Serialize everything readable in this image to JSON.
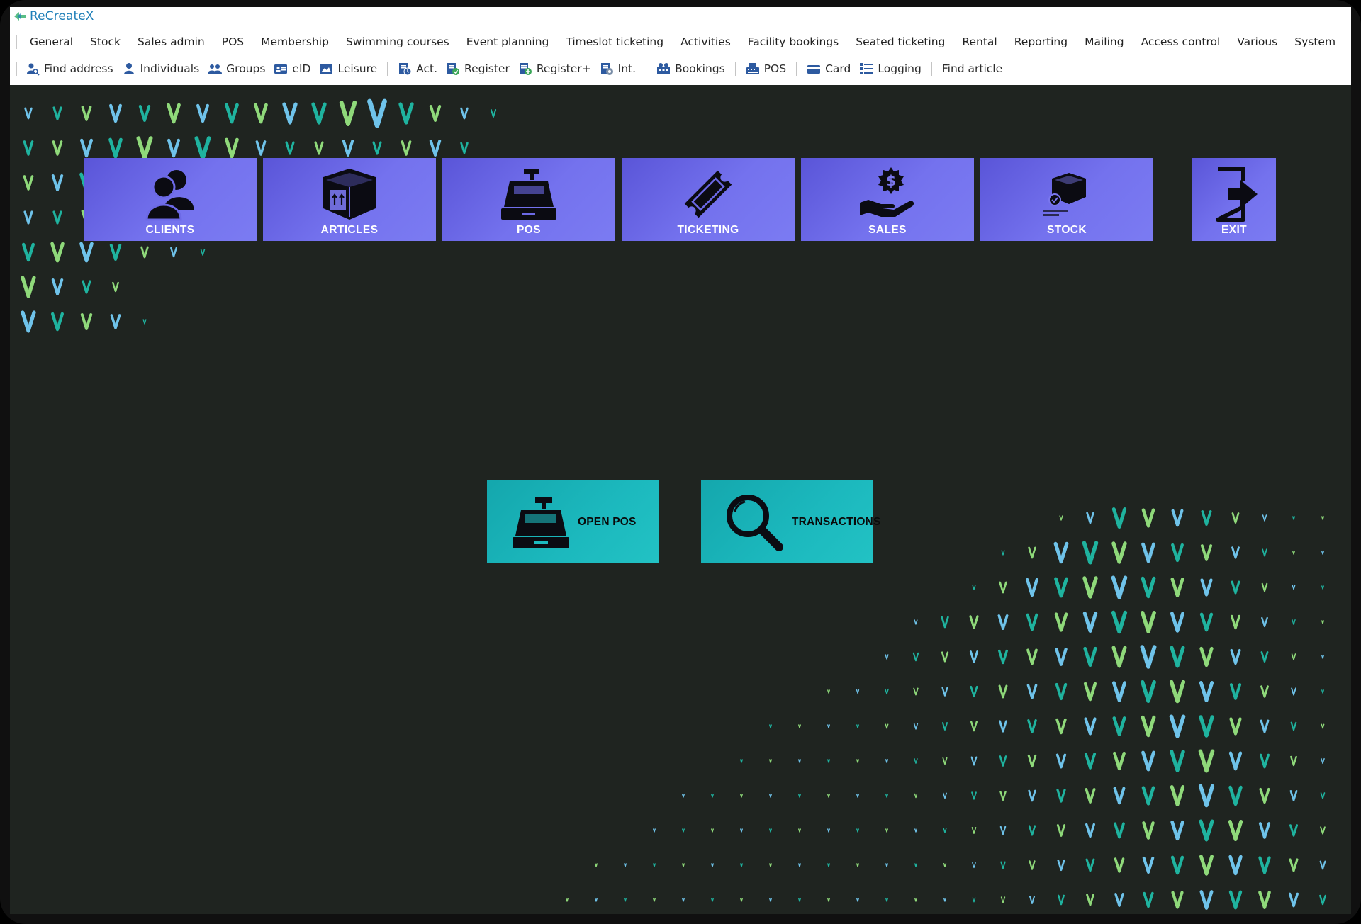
{
  "app": {
    "title": "ReCreateX"
  },
  "menubar": {
    "items": [
      "General",
      "Stock",
      "Sales admin",
      "POS",
      "Membership",
      "Swimming courses",
      "Event planning",
      "Timeslot ticketing",
      "Activities",
      "Facility bookings",
      "Seated ticketing",
      "Rental",
      "Reporting",
      "Mailing",
      "Access control",
      "Various",
      "System"
    ]
  },
  "toolbar": {
    "find_address": {
      "label": "Find address",
      "icon": "find-address-icon"
    },
    "individuals": {
      "label": "Individuals",
      "icon": "person-icon"
    },
    "groups": {
      "label": "Groups",
      "icon": "group-icon"
    },
    "eid": {
      "label": "eID",
      "icon": "id-card-icon"
    },
    "leisure": {
      "label": "Leisure",
      "icon": "picture-icon"
    },
    "act": {
      "label": "Act.",
      "icon": "activity-icon"
    },
    "register": {
      "label": "Register",
      "icon": "register-icon"
    },
    "register_plus": {
      "label": "Register+",
      "icon": "register-plus-icon"
    },
    "int": {
      "label": "Int.",
      "icon": "interest-icon"
    },
    "bookings": {
      "label": "Bookings",
      "icon": "bookings-icon"
    },
    "pos": {
      "label": "POS",
      "icon": "cash-register-icon"
    },
    "card": {
      "label": "Card",
      "icon": "card-icon"
    },
    "logging": {
      "label": "Logging",
      "icon": "list-icon"
    },
    "find_article": {
      "label": "Find article"
    }
  },
  "tiles": {
    "clients": "CLIENTS",
    "articles": "ARTICLES",
    "pos": "POS",
    "ticketing": "TICKETING",
    "sales": "SALES",
    "stock": "STOCK",
    "exit": "EXIT"
  },
  "actions": {
    "open_pos": "OPEN POS",
    "transactions": "TRANSACTIONS"
  },
  "colors": {
    "background": "#1f2420",
    "tile": "#6f6ced",
    "action": "#1cb9be",
    "pattern_blue": "#6fc3ea",
    "pattern_teal": "#1fb39f",
    "pattern_green": "#8fd97a",
    "app_title": "#1f7fb8"
  }
}
